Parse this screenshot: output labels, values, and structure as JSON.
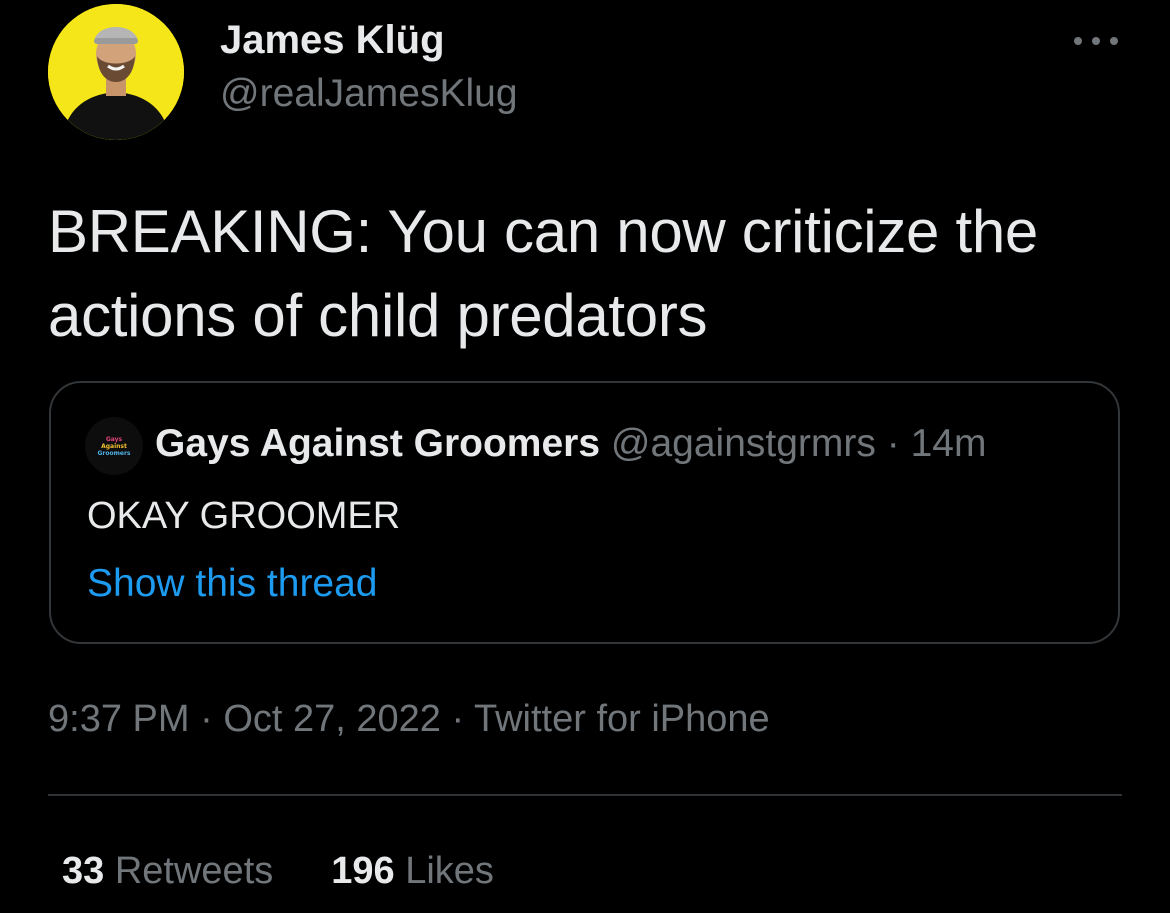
{
  "tweet": {
    "author": {
      "display_name": "James Klüg",
      "handle": "@realJamesKlug",
      "avatar": "profile-photo"
    },
    "more_icon": "more-horizontal-icon",
    "text_line1": "BREAKING: You can now criticize the",
    "text_line2": "actions of child predators",
    "quote": {
      "avatar_lines": [
        "Gays",
        "Against",
        "Groomers"
      ],
      "name": "Gays Against Groomers",
      "handle": "@againstgrmrs",
      "separator": "·",
      "time": "14m",
      "text": "OKAY GROOMER",
      "show_thread": "Show this thread"
    },
    "meta": {
      "time": "9:37 PM",
      "separator": "·",
      "date": "Oct 27, 2022",
      "source": "Twitter for iPhone"
    },
    "stats": {
      "retweets_count": "33",
      "retweets_label": "Retweets",
      "likes_count": "196",
      "likes_label": "Likes"
    }
  },
  "colors": {
    "background": "#000000",
    "primary_text": "#e7e9ea",
    "secondary_text": "#71767b",
    "link": "#1d9bf0",
    "border": "#333639",
    "avatar_bg": "#f5e61a"
  }
}
